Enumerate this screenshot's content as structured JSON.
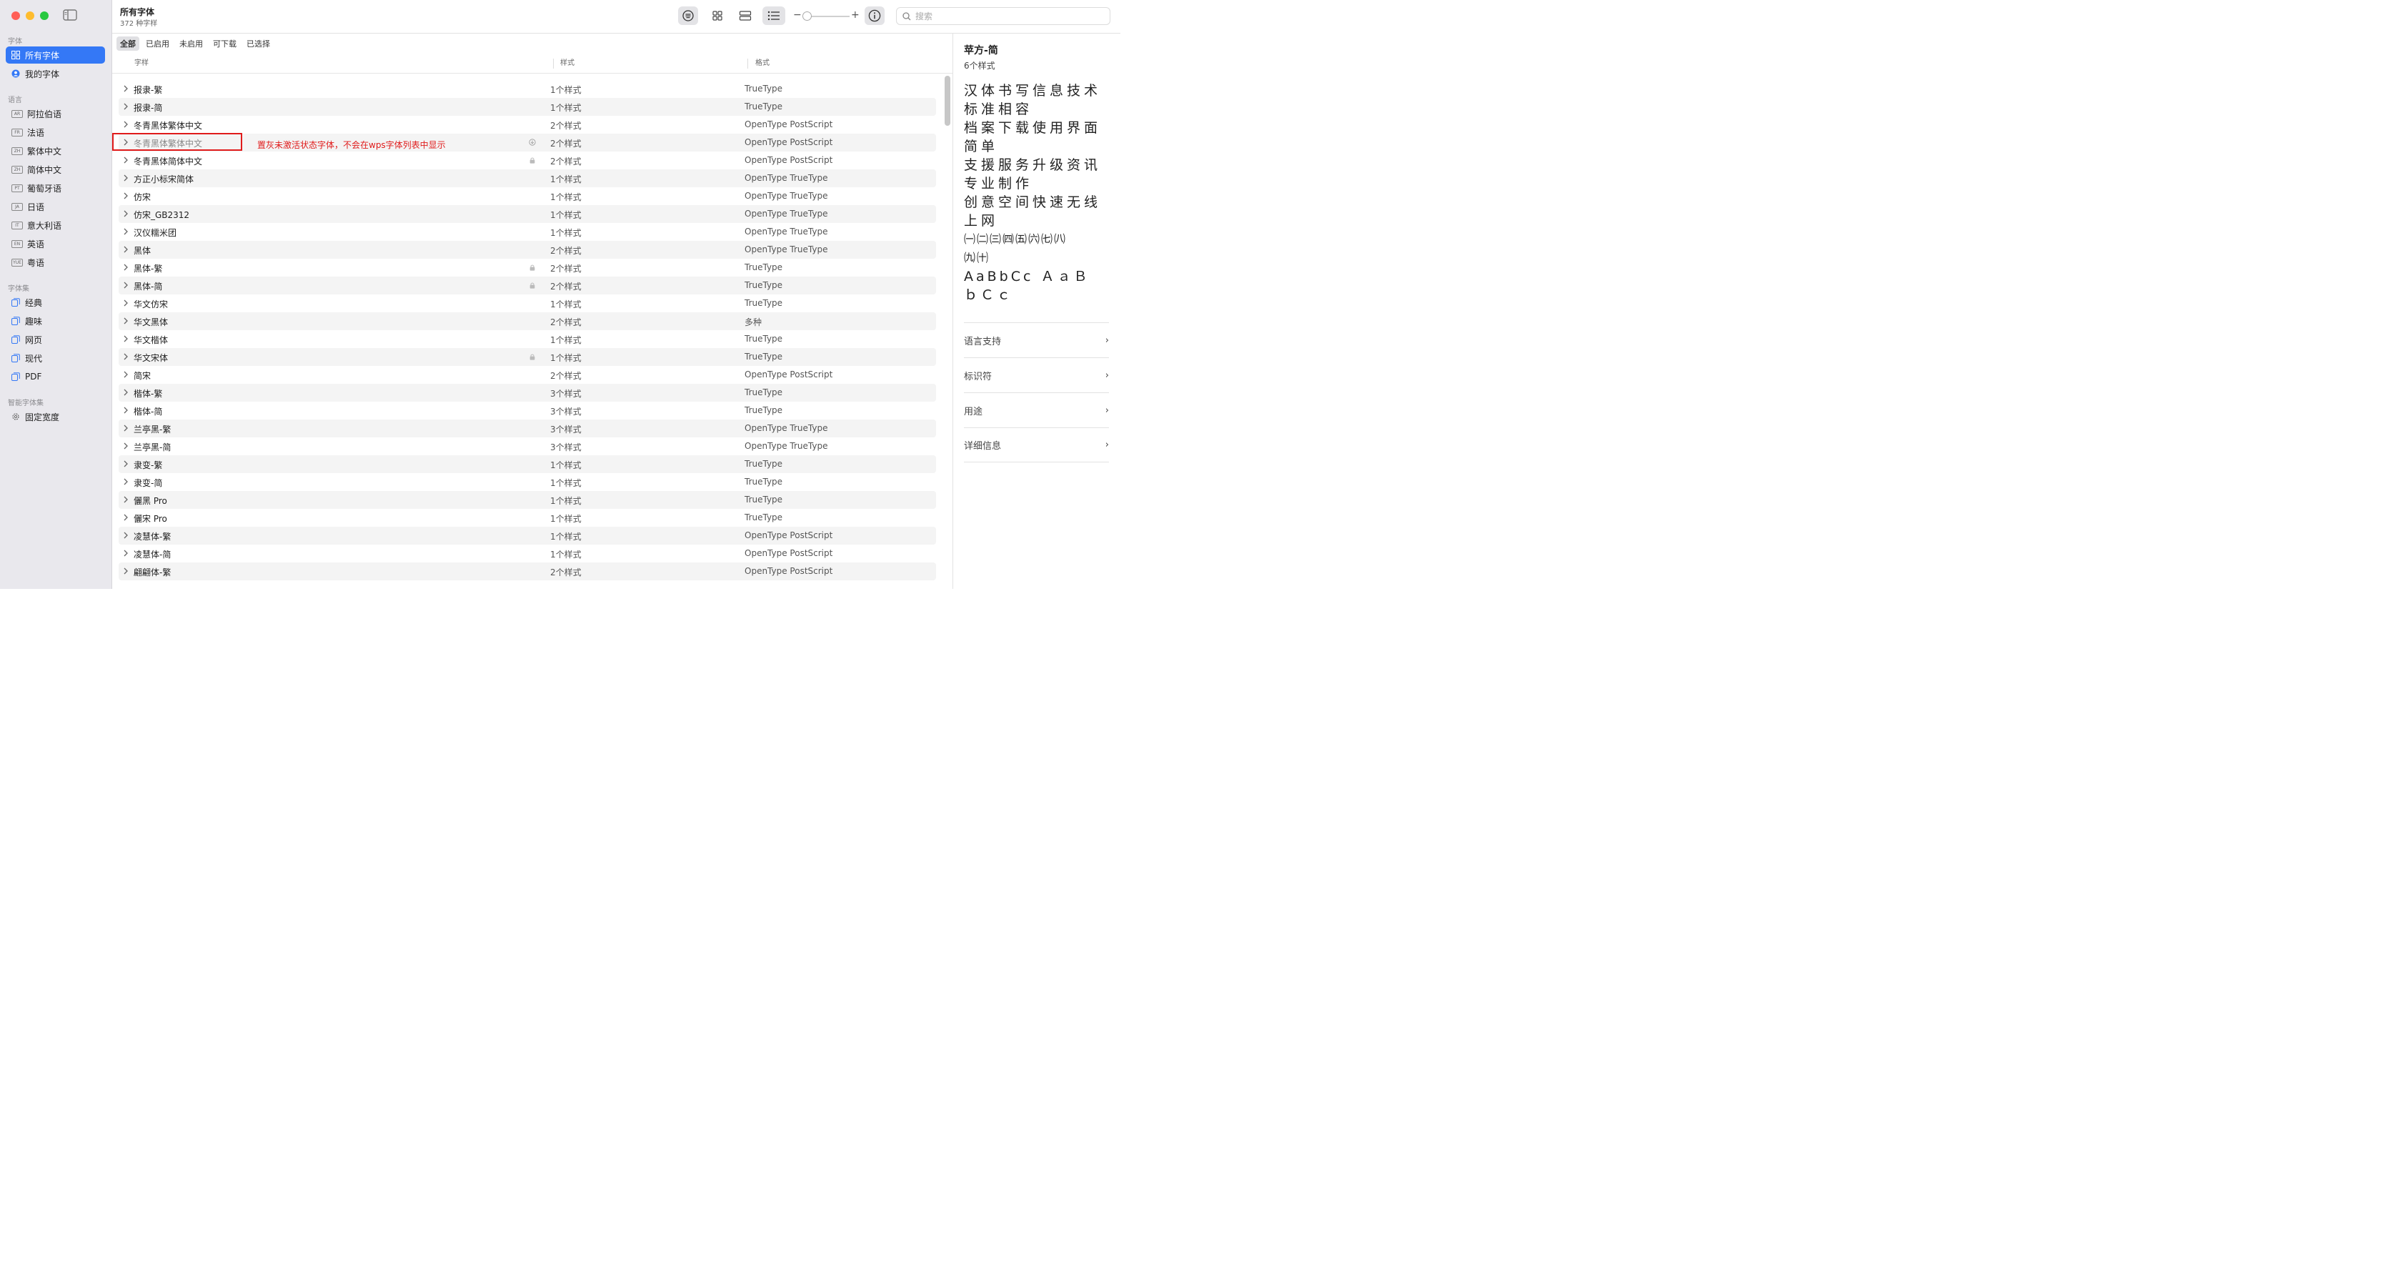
{
  "sidebar": {
    "sections": [
      {
        "title": "字体",
        "items": [
          {
            "label": "所有字体",
            "icon": "grid-icon",
            "active": true
          },
          {
            "label": "我的字体",
            "icon": "person-circle-icon"
          }
        ]
      },
      {
        "title": "语言",
        "items": [
          {
            "label": "阿拉伯语",
            "badge": "AR"
          },
          {
            "label": "法语",
            "badge": "FR"
          },
          {
            "label": "繁体中文",
            "badge": "ZH"
          },
          {
            "label": "简体中文",
            "badge": "ZH"
          },
          {
            "label": "葡萄牙语",
            "badge": "PT"
          },
          {
            "label": "日语",
            "badge": "JA"
          },
          {
            "label": "意大利语",
            "badge": "IT"
          },
          {
            "label": "英语",
            "badge": "EN"
          },
          {
            "label": "粤语",
            "badge": "YUE"
          }
        ]
      },
      {
        "title": "字体集",
        "items": [
          {
            "label": "经典",
            "icon": "collection-icon"
          },
          {
            "label": "趣味",
            "icon": "collection-icon"
          },
          {
            "label": "网页",
            "icon": "collection-icon"
          },
          {
            "label": "现代",
            "icon": "collection-icon"
          },
          {
            "label": "PDF",
            "icon": "collection-icon"
          }
        ]
      },
      {
        "title": "智能字体集",
        "items": [
          {
            "label": "固定宽度",
            "icon": "gear-icon"
          }
        ]
      }
    ]
  },
  "toolbar": {
    "title": "所有字体",
    "subtitle": "372 种字样",
    "zoom_minus": "−",
    "zoom_plus": "+",
    "search_placeholder": "搜索"
  },
  "filters": [
    "全部",
    "已启用",
    "未启用",
    "可下载",
    "已选择"
  ],
  "columns": {
    "name": "字样",
    "styles": "样式",
    "format": "格式"
  },
  "rows": [
    {
      "name": "报隶-繁",
      "styles": "1个样式",
      "format": "TrueType"
    },
    {
      "name": "报隶-简",
      "styles": "1个样式",
      "format": "TrueType"
    },
    {
      "name": "冬青黑体繁体中文",
      "styles": "2个样式",
      "format": "OpenType PostScript"
    },
    {
      "name": "冬青黑体繁体中文",
      "styles": "2个样式",
      "format": "OpenType PostScript",
      "status": "download",
      "gray": true
    },
    {
      "name": "冬青黑体简体中文",
      "styles": "2个样式",
      "format": "OpenType PostScript",
      "status": "lock"
    },
    {
      "name": "方正小标宋简体",
      "styles": "1个样式",
      "format": "OpenType TrueType"
    },
    {
      "name": "仿宋",
      "styles": "1个样式",
      "format": "OpenType TrueType"
    },
    {
      "name": "仿宋_GB2312",
      "styles": "1个样式",
      "format": "OpenType TrueType"
    },
    {
      "name": "汉仪糯米团",
      "styles": "1个样式",
      "format": "OpenType TrueType"
    },
    {
      "name": "黑体",
      "styles": "2个样式",
      "format": "OpenType TrueType"
    },
    {
      "name": "黑体-繁",
      "styles": "2个样式",
      "format": "TrueType",
      "status": "lock"
    },
    {
      "name": "黑体-简",
      "styles": "2个样式",
      "format": "TrueType",
      "status": "lock"
    },
    {
      "name": "华文仿宋",
      "styles": "1个样式",
      "format": "TrueType"
    },
    {
      "name": "华文黑体",
      "styles": "2个样式",
      "format": "多种"
    },
    {
      "name": "华文楷体",
      "styles": "1个样式",
      "format": "TrueType"
    },
    {
      "name": "华文宋体",
      "styles": "1个样式",
      "format": "TrueType",
      "status": "lock"
    },
    {
      "name": "简宋",
      "styles": "2个样式",
      "format": "OpenType PostScript"
    },
    {
      "name": "楷体-繁",
      "styles": "3个样式",
      "format": "TrueType"
    },
    {
      "name": "楷体-简",
      "styles": "3个样式",
      "format": "TrueType"
    },
    {
      "name": "兰亭黑-繁",
      "styles": "3个样式",
      "format": "OpenType TrueType"
    },
    {
      "name": "兰亭黑-简",
      "styles": "3个样式",
      "format": "OpenType TrueType"
    },
    {
      "name": "隶变-繁",
      "styles": "1个样式",
      "format": "TrueType"
    },
    {
      "name": "隶变-简",
      "styles": "1个样式",
      "format": "TrueType"
    },
    {
      "name": "儷黑 Pro",
      "styles": "1个样式",
      "format": "TrueType"
    },
    {
      "name": "儷宋 Pro",
      "styles": "1个样式",
      "format": "TrueType"
    },
    {
      "name": "凌慧体-繁",
      "styles": "1个样式",
      "format": "OpenType PostScript"
    },
    {
      "name": "凌慧体-简",
      "styles": "1个样式",
      "format": "OpenType PostScript"
    },
    {
      "name": "翩翩体-繁",
      "styles": "2个样式",
      "format": "OpenType PostScript"
    }
  ],
  "annotation": "置灰未激活状态字体，不会在wps字体列表中显示",
  "right_panel": {
    "title": "苹方-简",
    "subtitle": "6个样式",
    "sample_lines": [
      "汉体书写信息技术",
      "标准相容",
      "档案下载使用界面",
      "简单",
      "支援服务升级资讯",
      "专业制作",
      "创意空间快速无线",
      "上网",
      "㈠㈡㈢㈣㈤㈥㈦㈧",
      "㈨㈩"
    ],
    "sample_latin": [
      "AaBbCc ＡａＢ",
      "ｂＣｃ"
    ],
    "sections": [
      "语言支持",
      "标识符",
      "用途",
      "详细信息"
    ]
  }
}
